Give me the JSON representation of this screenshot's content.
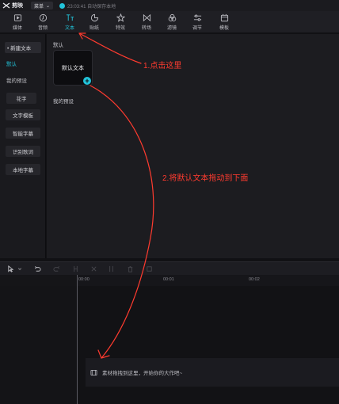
{
  "titlebar": {
    "app_name": "剪映",
    "menu_label": "菜单",
    "save_status": "23:03:41 自动保存本地"
  },
  "toolbar": {
    "tools": [
      {
        "label": "媒体",
        "icon": "media-icon"
      },
      {
        "label": "音频",
        "icon": "audio-icon"
      },
      {
        "label": "文本",
        "icon": "text-icon"
      },
      {
        "label": "贴纸",
        "icon": "sticker-icon"
      },
      {
        "label": "特效",
        "icon": "effects-icon"
      },
      {
        "label": "转场",
        "icon": "transition-icon"
      },
      {
        "label": "滤镜",
        "icon": "filter-icon"
      },
      {
        "label": "调节",
        "icon": "adjust-icon"
      },
      {
        "label": "模板",
        "icon": "template-icon"
      }
    ],
    "active": "文本"
  },
  "sidebar": {
    "header": "• 新建文本",
    "items": [
      {
        "label": "默认"
      },
      {
        "label": "我的预设"
      },
      {
        "label": "花字"
      },
      {
        "label": "文字模板"
      },
      {
        "label": "智能字幕"
      },
      {
        "label": "识别歌词"
      },
      {
        "label": "本地字幕"
      }
    ]
  },
  "assets": {
    "section_default": "默认",
    "default_card_label": "默认文本",
    "section_presets": "我的预设"
  },
  "timeline": {
    "ruler": [
      "00:00",
      "00:01",
      "00:02"
    ],
    "empty_track_hint": "素材拖拽到这里，开始你的大作吧~"
  },
  "annotations": {
    "step1": "1.点击这里",
    "step2": "2.将默认文本拖动到下面"
  },
  "colors": {
    "accent": "#22c3d9",
    "annotation": "#ff3b2f"
  }
}
